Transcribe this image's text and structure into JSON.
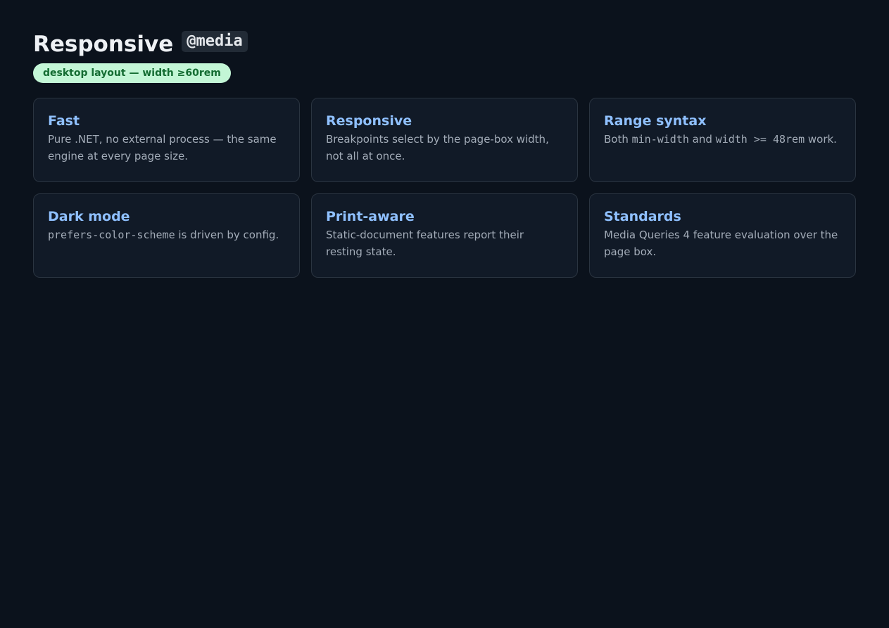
{
  "header": {
    "title": "Responsive",
    "code_chip": "@media",
    "badge": "desktop layout — width ≥60rem"
  },
  "cards": [
    {
      "title": "Fast",
      "body": "Pure .NET, no external process — the same engine at every page size."
    },
    {
      "title": "Responsive",
      "body": "Breakpoints select by the page-box width, not all at once."
    },
    {
      "title": "Range syntax",
      "body_parts": [
        "Both ",
        "min-width",
        " and ",
        "width >= 48rem",
        " work."
      ]
    },
    {
      "title": "Dark mode",
      "body_parts": [
        "prefers-color-scheme",
        " is driven by config."
      ]
    },
    {
      "title": "Print-aware",
      "body": "Static-document features report their resting state."
    },
    {
      "title": "Standards",
      "body": "Media Queries 4 feature evaluation over the page box."
    }
  ],
  "colors": {
    "background": "#0b121c",
    "card_background": "#111a27",
    "card_title": "#8fc0ff",
    "badge_background": "#c3f6d6",
    "badge_text": "#146c32"
  }
}
